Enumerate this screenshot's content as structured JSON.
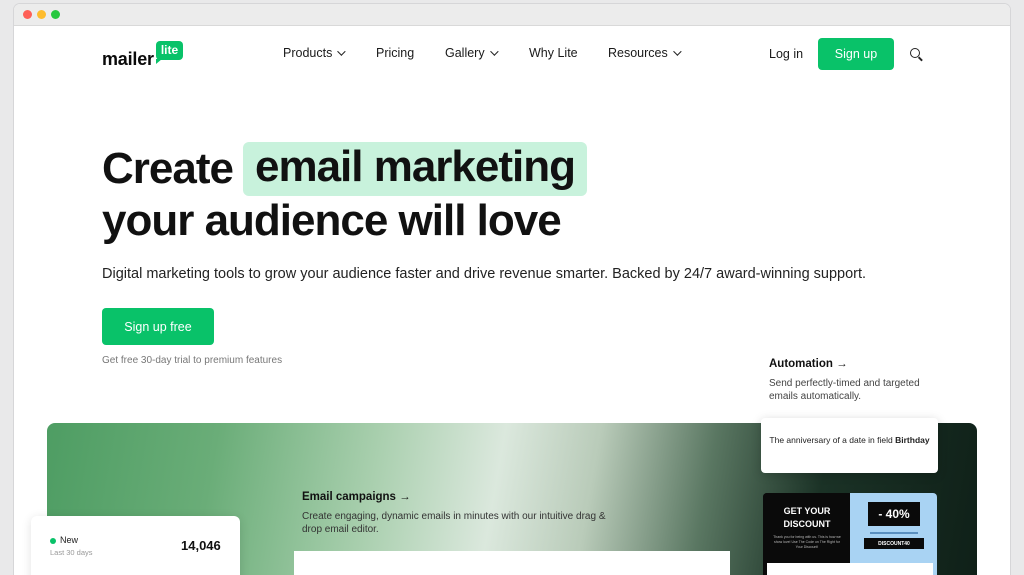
{
  "nav": {
    "logo_main": "mailer",
    "logo_badge": "lite",
    "items": [
      {
        "label": "Products"
      },
      {
        "label": "Pricing"
      },
      {
        "label": "Gallery"
      },
      {
        "label": "Why Lite"
      },
      {
        "label": "Resources"
      }
    ],
    "login": "Log in",
    "signup": "Sign up"
  },
  "hero": {
    "title_pre": "Create",
    "title_highlight": "email marketing",
    "title_line2": "your audience will love",
    "subtitle": "Digital marketing tools to grow your audience faster and drive revenue smarter. Backed by 24/7 award-winning support.",
    "cta": "Sign up free",
    "trial_note": "Get free 30-day trial to premium features"
  },
  "automation": {
    "title": "Automation →",
    "desc": "Send perfectly-timed and targeted emails automatically."
  },
  "campaigns": {
    "title": "Email campaigns →",
    "desc": "Create engaging, dynamic emails in minutes with our intuitive drag & drop email editor."
  },
  "stat": {
    "label": "New",
    "sub": "Last 30 days",
    "value": "14,046"
  },
  "trigger": {
    "text": "The anniversary of a date in field",
    "field": "Birthday"
  },
  "email_preview": {
    "heading": "GET YOUR DISCOUNT",
    "small_text": "Thank you for being with us. This is how we show love! Use The Code on The Right for Your Discount!",
    "discount": "- 40%",
    "code": "DISCOUNT40"
  },
  "colors": {
    "brand_green": "#09c269",
    "highlight_mint": "#c8f2dc"
  }
}
